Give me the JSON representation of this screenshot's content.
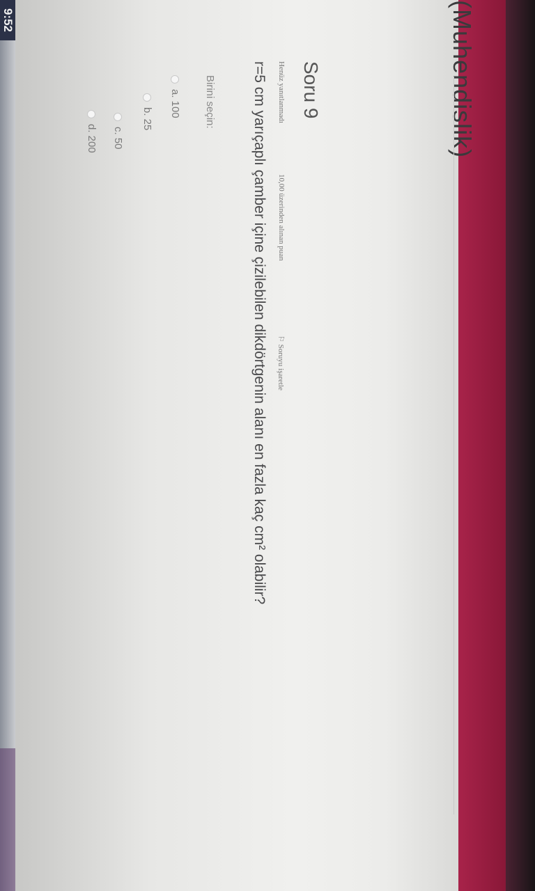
{
  "taskbar": {
    "clock": "9:52"
  },
  "course": {
    "title": "(Muhendislik)"
  },
  "question": {
    "title": "Soru 9",
    "status": "Henüz yanıtlanmadı",
    "points": "10,00 üzerinden alınan puan",
    "flag_label": "Soruyu işaretle",
    "text": "r=5 cm yarıçaplı çamber içine çizilebilen dikdörtgenin alanı en fazla kaç cm² olabilir?",
    "prompt": "Birini seçin:",
    "options": [
      {
        "label": "a. 100"
      },
      {
        "label": "b. 25"
      },
      {
        "label": "c. 50"
      },
      {
        "label": "d. 200"
      }
    ]
  }
}
